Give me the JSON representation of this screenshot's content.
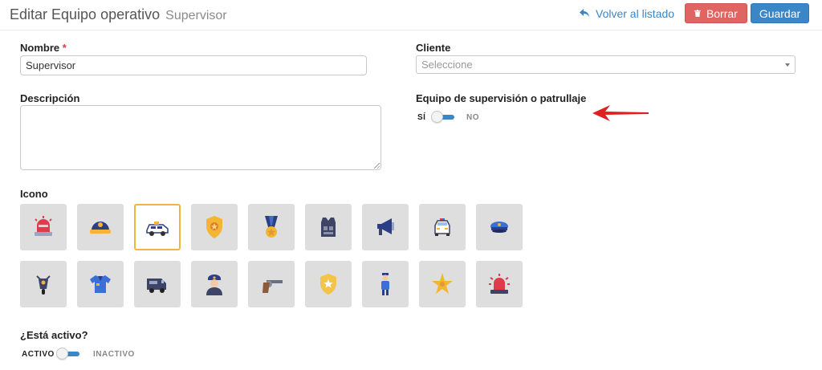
{
  "header": {
    "title": "Editar Equipo operativo",
    "subtitle": "Supervisor",
    "back_label": "Volver al listado",
    "delete_label": "Borrar",
    "save_label": "Guardar"
  },
  "form": {
    "nombre": {
      "label": "Nombre",
      "required_mark": "*",
      "value": "Supervisor"
    },
    "cliente": {
      "label": "Cliente",
      "placeholder": "Seleccione"
    },
    "descripcion": {
      "label": "Descripción",
      "value": ""
    },
    "supervision": {
      "label": "Equipo de supervisión o patrullaje",
      "on_label": "SÍ",
      "off_label": "NO"
    },
    "icono": {
      "label": "Icono",
      "selected": "patrol-car",
      "rows": [
        [
          "siren",
          "police-helmet",
          "patrol-car",
          "police-badge",
          "medal",
          "bulletproof-vest",
          "megaphone",
          "police-car-front",
          "police-cap"
        ],
        [
          "motorcycle",
          "police-shirt",
          "police-van",
          "police-officer",
          "revolver",
          "shield-star",
          "officer-standing",
          "sheriff-star",
          "alarm-light"
        ]
      ]
    },
    "activo": {
      "label": "¿Está activo?",
      "on_label": "ACTIVO",
      "off_label": "INACTIVO"
    }
  },
  "colors": {
    "primary": "#3b86c6",
    "danger": "#e06461",
    "selected_border": "#efb542",
    "tile_bg": "#dedede",
    "annotation_arrow": "#e02020"
  }
}
